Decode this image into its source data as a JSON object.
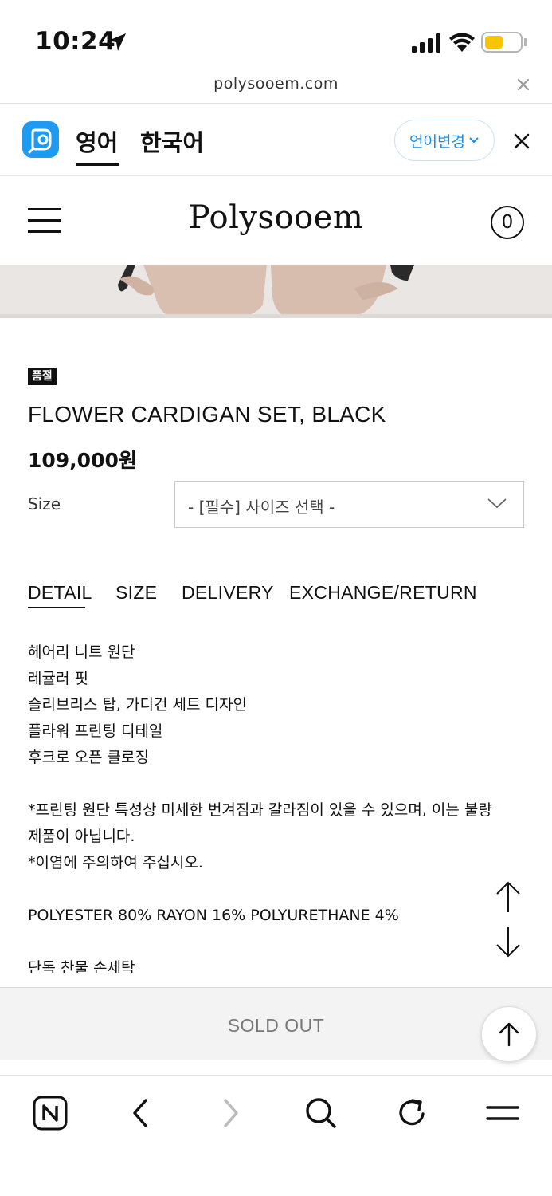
{
  "status_bar": {
    "time": "10:24"
  },
  "url_bar": {
    "url": "polysooem.com"
  },
  "translate_bar": {
    "tab_english": "영어",
    "tab_korean": "한국어",
    "change_language_label": "언어변경",
    "accent_color": "#1f8be0"
  },
  "header": {
    "brand": "Polysooem",
    "cart_count": "0"
  },
  "product": {
    "badge": "품절",
    "name": "FLOWER CARDIGAN SET, BLACK",
    "price": "109,000원",
    "size_label": "Size",
    "size_select_value": "- [필수] 사이즈 선택 -"
  },
  "tabs": [
    {
      "label": "DETAIL"
    },
    {
      "label": "SIZE"
    },
    {
      "label": "DELIVERY"
    },
    {
      "label": "EXCHANGE/RETURN"
    }
  ],
  "detail": {
    "lines": [
      "헤어리 니트 원단",
      "레귤러 핏",
      "슬리브리스 탑, 가디건 세트 디자인",
      "플라워 프린팅 디테일",
      "후크로 오픈 클로징",
      "",
      "*프린팅 원단 특성상 미세한 번겨짐과 갈라짐이 있을 수 있으며, 이는 불량",
      "제품이 아닙니다.",
      "*이염에 주의하여 주십시오.",
      "",
      "POLYESTER 80% RAYON 16% POLYURETHANE 4%",
      "",
      "단독 찬물 손세탁"
    ]
  },
  "purchase": {
    "sold_out_label": "SOLD OUT"
  },
  "toolbar": {
    "icons": [
      "naver-home-icon",
      "back-icon",
      "forward-icon",
      "search-icon",
      "reload-icon",
      "menu-icon"
    ]
  }
}
